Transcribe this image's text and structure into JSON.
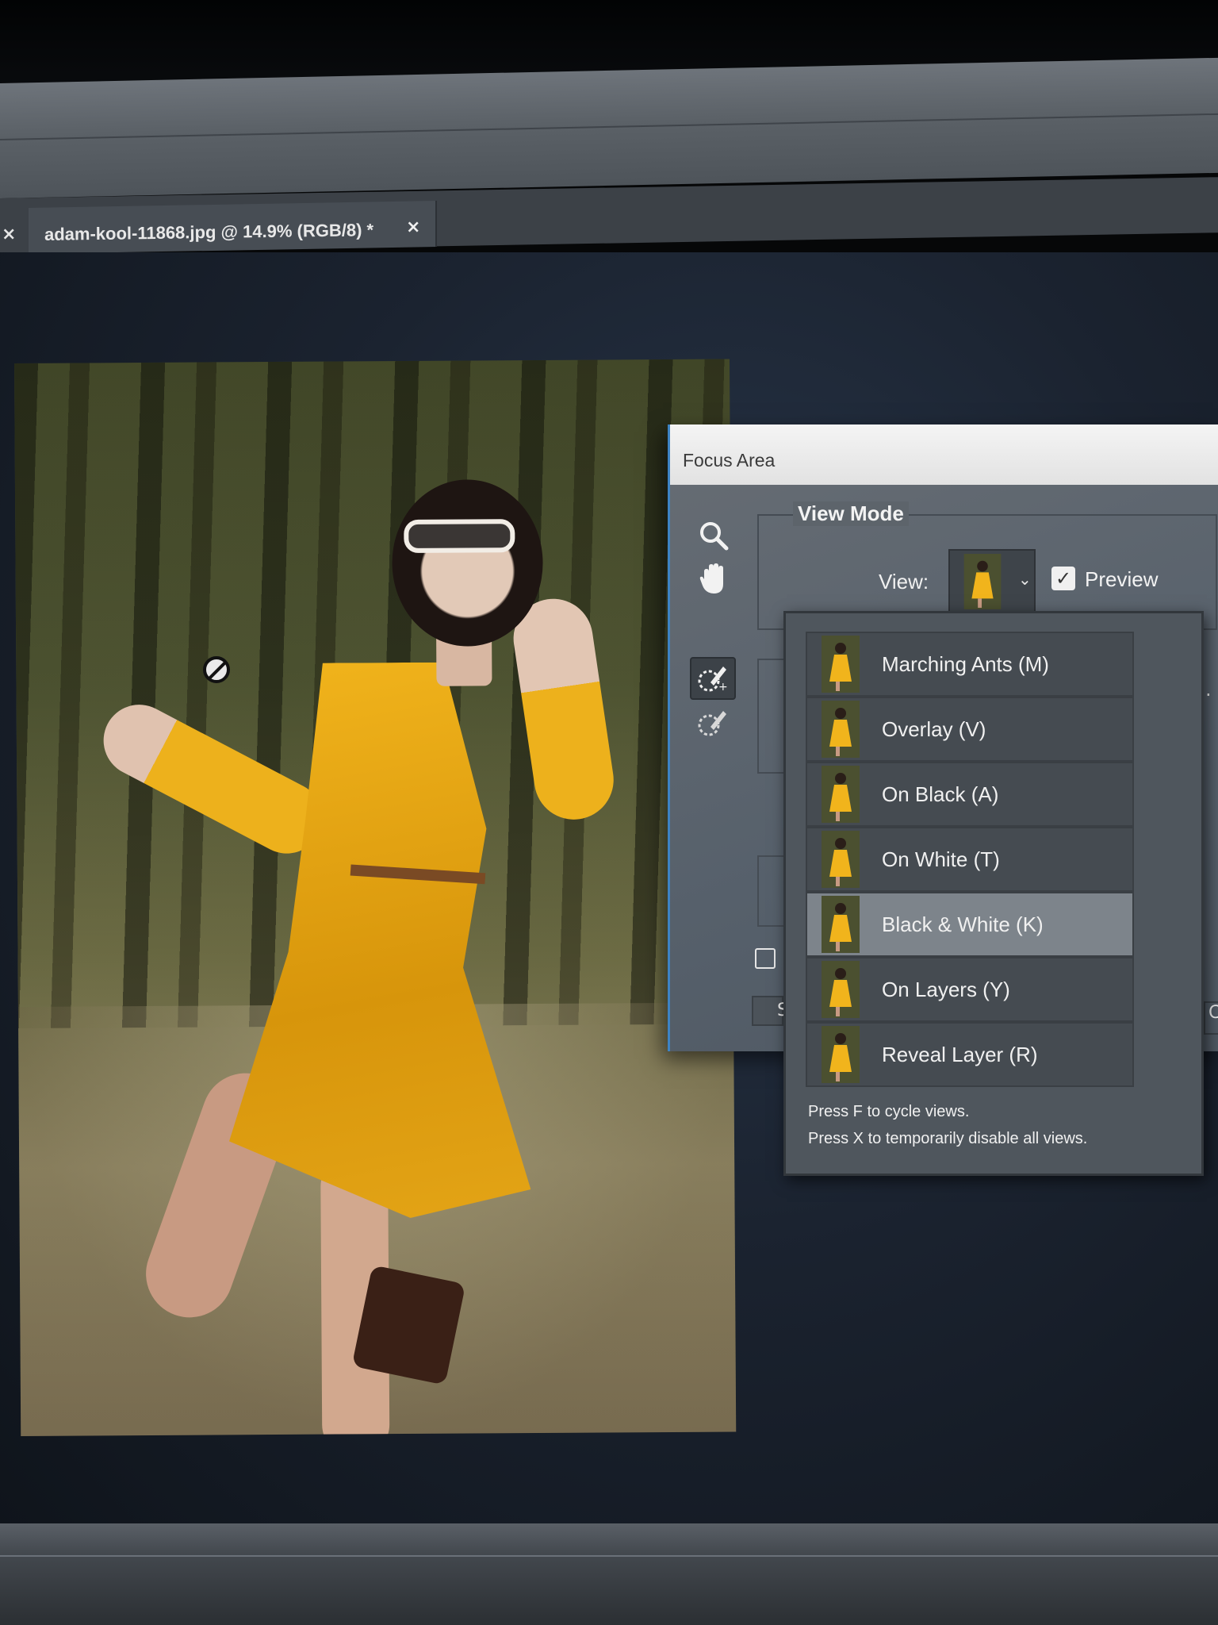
{
  "document_tab": {
    "title": "adam-kool-11868.jpg @ 14.9% (RGB/8) *",
    "close_glyph": "×",
    "prev_close_glyph": "×"
  },
  "dialog": {
    "title": "Focus Area",
    "view_mode": {
      "group_label": "View Mode",
      "view_label": "View:",
      "selected_view": "Black & White (K)",
      "preview_label": "Preview",
      "preview_checked": true
    },
    "tools": [
      "zoom-icon",
      "hand-icon",
      "focus-area-add-brush-icon",
      "focus-area-subtract-brush-icon"
    ],
    "left_button_fragment": "S",
    "right_button_fragment": "C"
  },
  "view_dropdown": {
    "items": [
      {
        "label": "Marching Ants (M)",
        "selected": false
      },
      {
        "label": "Overlay (V)",
        "selected": false
      },
      {
        "label": "On Black (A)",
        "selected": false
      },
      {
        "label": "On White (T)",
        "selected": false
      },
      {
        "label": "Black & White (K)",
        "selected": true
      },
      {
        "label": "On Layers (Y)",
        "selected": false
      },
      {
        "label": "Reveal Layer (R)",
        "selected": false
      }
    ],
    "hint_cycle": "Press F to cycle views.",
    "hint_disable": "Press X to temporarily disable all views."
  },
  "colors": {
    "dialog_bg": "#5d646b",
    "selected_item": "#7d848b",
    "dialog_border_accent": "#3d83c4",
    "dress_yellow": "#f1b41c"
  }
}
